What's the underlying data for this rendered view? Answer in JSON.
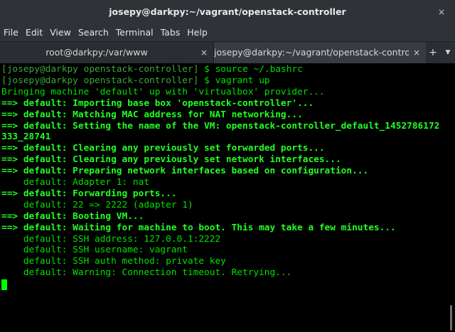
{
  "window": {
    "title": "josepy@darkpy:~/vagrant/openstack-controller",
    "close_glyph": "×"
  },
  "menu": [
    "File",
    "Edit",
    "View",
    "Search",
    "Terminal",
    "Tabs",
    "Help"
  ],
  "tabs": [
    {
      "label": "root@darkpy:/var/www",
      "close_glyph": "×",
      "active": false
    },
    {
      "label": "josepy@darkpy:~/vagrant/openstack-control...",
      "close_glyph": "×",
      "active": true
    }
  ],
  "tab_controls": {
    "add": "+",
    "menu": "▼"
  },
  "prompt": {
    "open": "[",
    "user": "josepy@darkpy",
    "dir": "openstack-controller",
    "close": "]",
    "symbol": "$"
  },
  "lines": [
    {
      "type": "cmd",
      "command": "source ~/.bashrc"
    },
    {
      "type": "cmd",
      "command": "vagrant up"
    },
    {
      "type": "plain",
      "text": "Bringing machine 'default' up with 'virtualbox' provider..."
    },
    {
      "type": "bold",
      "text": "==> default: Importing base box 'openstack-controller'..."
    },
    {
      "type": "bold",
      "text": "==> default: Matching MAC address for NAT networking..."
    },
    {
      "type": "bold",
      "text": "==> default: Setting the name of the VM: openstack-controller_default_1452786172"
    },
    {
      "type": "bold",
      "text": "333_28741"
    },
    {
      "type": "bold",
      "text": "==> default: Clearing any previously set forwarded ports..."
    },
    {
      "type": "bold",
      "text": "==> default: Clearing any previously set network interfaces..."
    },
    {
      "type": "bold",
      "text": "==> default: Preparing network interfaces based on configuration..."
    },
    {
      "type": "plain",
      "text": "    default: Adapter 1: nat"
    },
    {
      "type": "bold",
      "text": "==> default: Forwarding ports..."
    },
    {
      "type": "plain",
      "text": "    default: 22 => 2222 (adapter 1)"
    },
    {
      "type": "bold",
      "text": "==> default: Booting VM..."
    },
    {
      "type": "bold",
      "text": "==> default: Waiting for machine to boot. This may take a few minutes..."
    },
    {
      "type": "plain",
      "text": "    default: SSH address: 127.0.0.1:2222"
    },
    {
      "type": "plain",
      "text": "    default: SSH username: vagrant"
    },
    {
      "type": "plain",
      "text": "    default: SSH auth method: private key"
    },
    {
      "type": "plain",
      "text": "    default: Warning: Connection timeout. Retrying..."
    }
  ]
}
